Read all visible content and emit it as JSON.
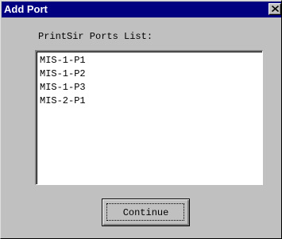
{
  "window": {
    "title": "Add Port"
  },
  "dialog": {
    "list_label": "PrintSir Ports List:",
    "ports": [
      "MIS-1-P1",
      "MIS-1-P2",
      "MIS-1-P3",
      "MIS-2-P1"
    ],
    "continue_label": "Continue"
  },
  "icons": {
    "close": "close-icon"
  },
  "colors": {
    "titlebar": "#000080",
    "face": "#c0c0c0"
  }
}
